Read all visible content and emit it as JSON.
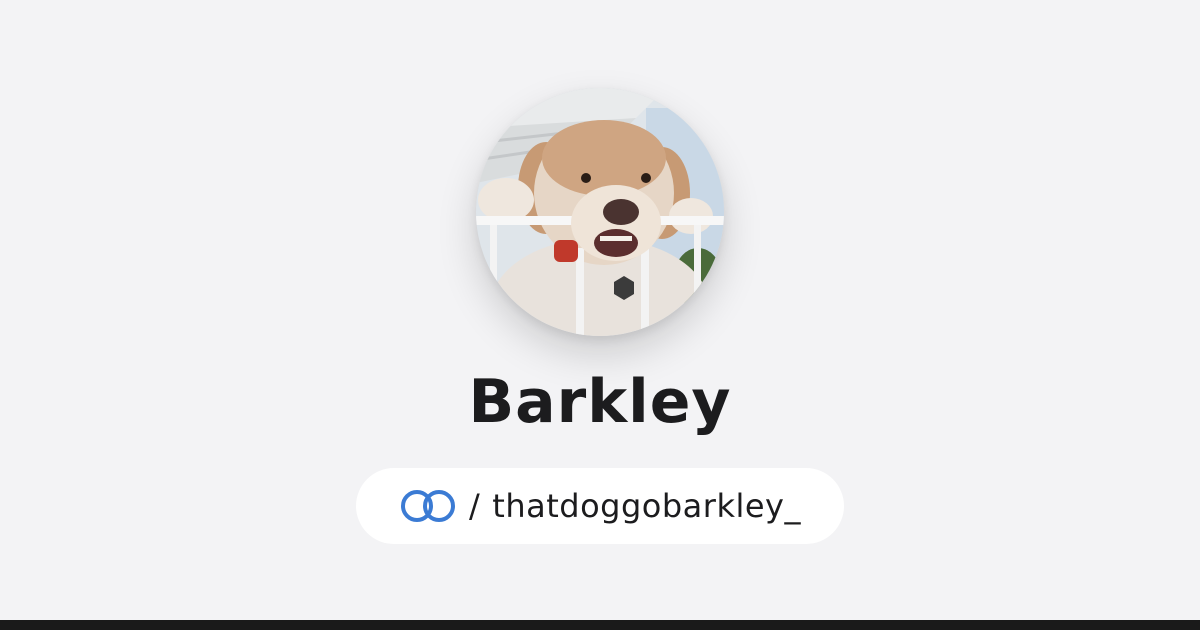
{
  "profile": {
    "name": "Barkley",
    "handle_separator": "/",
    "handle": "thatdoggobarkley_",
    "link_icon": "linked-rings-icon",
    "avatar_icon": "profile-photo"
  },
  "colors": {
    "background": "#f3f3f5",
    "pill": "#ffffff",
    "text": "#1c1c1e",
    "accent": "#3b7bd4",
    "bottom_bar": "#1a1a1a"
  }
}
